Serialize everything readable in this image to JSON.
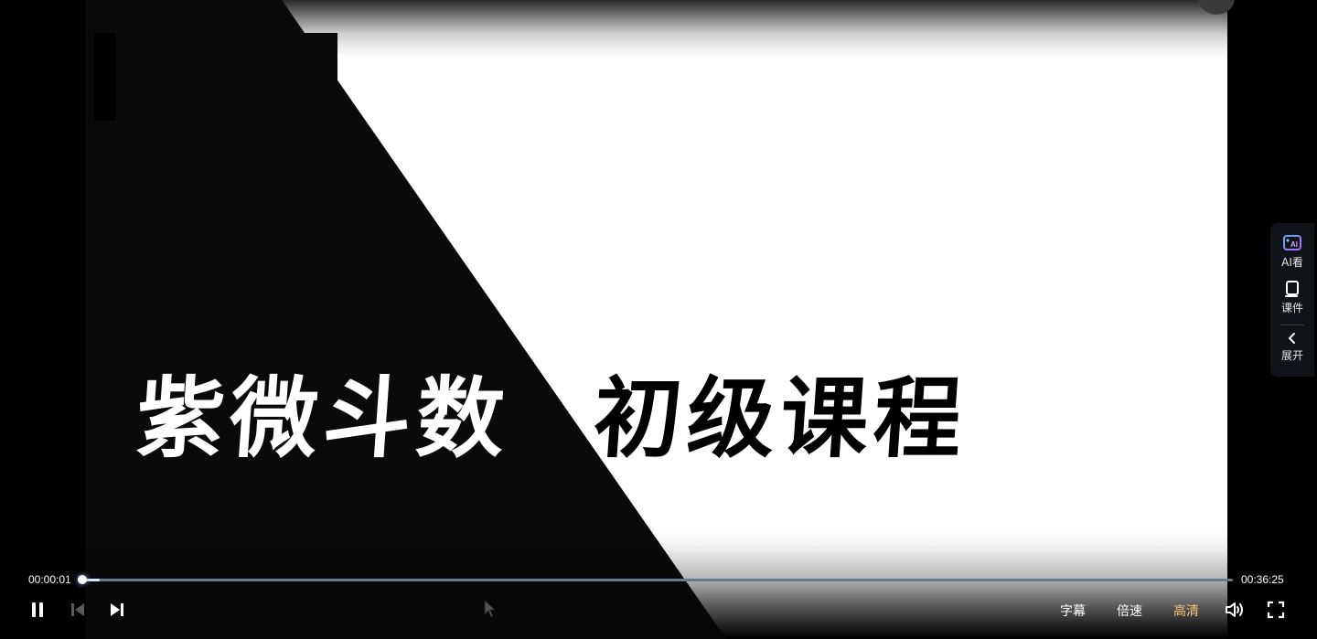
{
  "video": {
    "title_part1": "紫微斗数",
    "title_part2": "初级课程"
  },
  "side_panel": {
    "items": [
      {
        "label": "AI看",
        "icon": "ai-view-icon"
      },
      {
        "label": "课件",
        "icon": "courseware-icon"
      },
      {
        "label": "展开",
        "icon": "chevron-left-icon"
      }
    ]
  },
  "controls": {
    "current_time": "00:00:01",
    "total_time": "00:36:25",
    "progress_fraction": 0.0005,
    "subtitle_label": "字幕",
    "speed_label": "倍速",
    "quality_label": "高清",
    "icons": [
      "pause-icon",
      "previous-icon",
      "next-icon",
      "volume-icon",
      "fullscreen-icon"
    ]
  },
  "colors": {
    "accent_quality": "#f5c77a",
    "progress_track": "#6c7890",
    "side_panel_bg": "#101317"
  }
}
